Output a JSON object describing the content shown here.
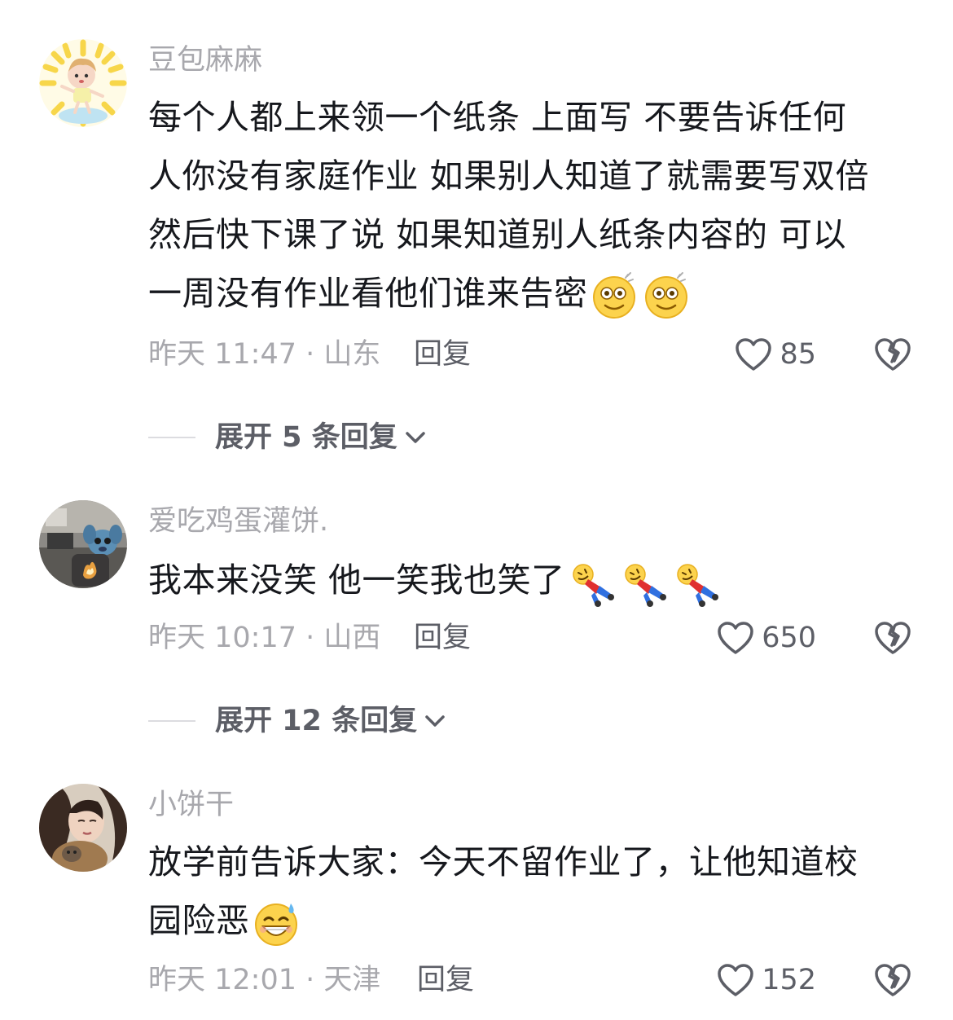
{
  "comments": [
    {
      "username": "豆包麻麻",
      "content_lines": [
        "每个人都上来领一个纸条 上面写 不要告诉任何",
        "人你没有家庭作业 如果别人知道了就需要写双倍",
        "然后快下课了说 如果知道别人纸条内容的 可以",
        "一周没有作业看他们谁来告密"
      ],
      "emoji_name": "dizzy-face-emoji",
      "time": "昨天 11:47 · 山东",
      "reply_label": "回复",
      "likes": "85",
      "expand_label": "展开 5 条回复"
    },
    {
      "username": "爱吃鸡蛋灌饼.",
      "content_lines": [
        "我本来没笑  他一笑我也笑了"
      ],
      "emoji_name": "rolling-laughing-person-emoji",
      "time": "昨天 10:17 · 山西",
      "reply_label": "回复",
      "likes": "650",
      "expand_label": "展开 12 条回复"
    },
    {
      "username": "小饼干",
      "content_lines": [
        "放学前告诉大家：今天不留作业了，让他知道校",
        "园险恶"
      ],
      "emoji_name": "grinning-sweat-emoji",
      "time": "昨天 12:01 · 天津",
      "reply_label": "回复",
      "likes": "152"
    }
  ],
  "colors": {
    "username": "#a8a8ad",
    "content": "#16181d",
    "meta": "#a8a8ad",
    "action": "#5c5e66",
    "background": "#ffffff"
  },
  "icons": {
    "like": "heart-outline-icon",
    "dislike": "broken-heart-icon",
    "expand": "chevron-down-icon"
  }
}
